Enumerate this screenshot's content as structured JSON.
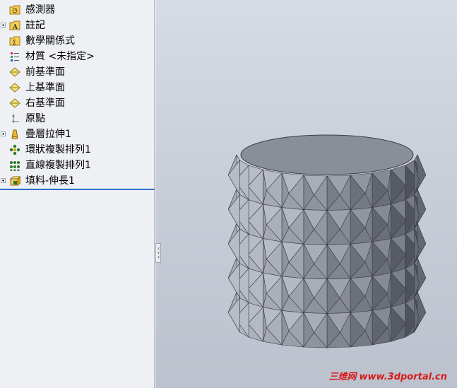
{
  "feature_tree": {
    "items": [
      {
        "label": "感測器",
        "icon": "sensor-icon",
        "expandable": false
      },
      {
        "label": "註記",
        "icon": "annotation-icon",
        "expandable": true
      },
      {
        "label": "數學關係式",
        "icon": "equations-icon",
        "expandable": false
      },
      {
        "label": "材質 <未指定>",
        "icon": "material-icon",
        "expandable": false
      },
      {
        "label": "前基準面",
        "icon": "plane-icon",
        "expandable": false
      },
      {
        "label": "上基準面",
        "icon": "plane-icon",
        "expandable": false
      },
      {
        "label": "右基準面",
        "icon": "plane-icon",
        "expandable": false
      },
      {
        "label": "原點",
        "icon": "origin-icon",
        "expandable": false
      },
      {
        "label": "疊層拉伸1",
        "icon": "loft-icon",
        "expandable": true
      },
      {
        "label": "環狀複製排列1",
        "icon": "circular-pattern-icon",
        "expandable": false
      },
      {
        "label": "直線複製排列1",
        "icon": "linear-pattern-icon",
        "expandable": false
      },
      {
        "label": "填料-伸長1",
        "icon": "extrude-icon",
        "expandable": true
      }
    ]
  },
  "watermark": {
    "site_cn": "三维网",
    "url": "www.3dportal.cn"
  },
  "colors": {
    "model_face": "#8b8f99",
    "model_dark": "#4e525b",
    "model_light": "#aeb2bb",
    "rollback_bar": "#2d6ec6"
  }
}
